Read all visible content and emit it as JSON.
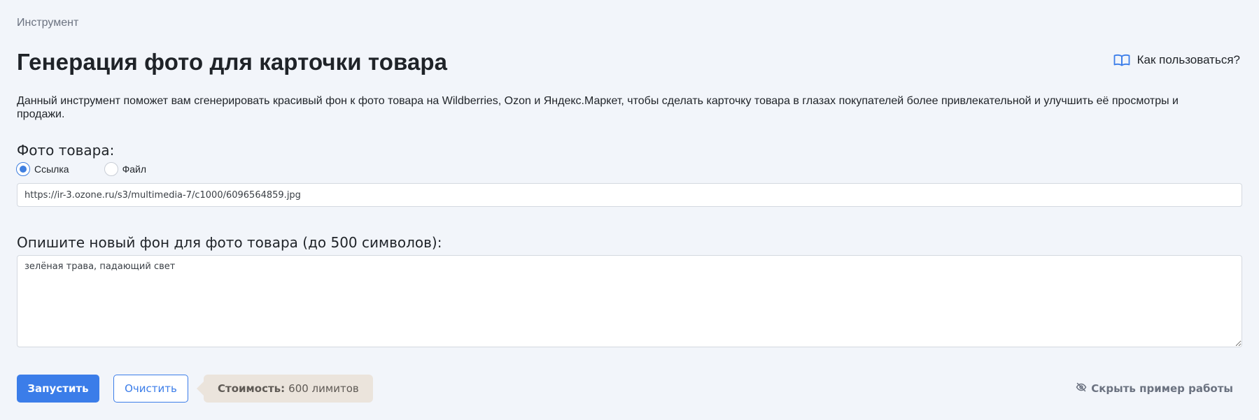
{
  "breadcrumb": "Инструмент",
  "title": "Генерация фото для карточки товара",
  "help_link": {
    "label": "Как пользоваться?",
    "icon": "book-icon"
  },
  "description": "Данный инструмент поможет вам сгенерировать красивый фон к фото товара на Wildberries, Ozon и Яндекс.Маркет, чтобы сделать карточку товара в глазах покупателей более привлекательной и улучшить её просмотры и продажи.",
  "photo_section": {
    "label": "Фото товара:",
    "options": [
      {
        "label": "Ссылка",
        "checked": true
      },
      {
        "label": "Файл",
        "checked": false
      }
    ],
    "url_value": "https://ir-3.ozone.ru/s3/multimedia-7/c1000/6096564859.jpg"
  },
  "background_section": {
    "label": "Опишите новый фон для фото товара (до 500 символов):",
    "value": "зелёная трава, падающий свет"
  },
  "actions": {
    "run_label": "Запустить",
    "clear_label": "Очистить",
    "cost_label": "Стоимость:",
    "cost_value": "600 лимитов",
    "hide_example_label": "Скрыть пример работы",
    "hide_example_icon": "eye-off-icon"
  },
  "colors": {
    "accent": "#3b7de9",
    "background": "#f2f5fa",
    "cost_badge": "#ebe4dc"
  }
}
